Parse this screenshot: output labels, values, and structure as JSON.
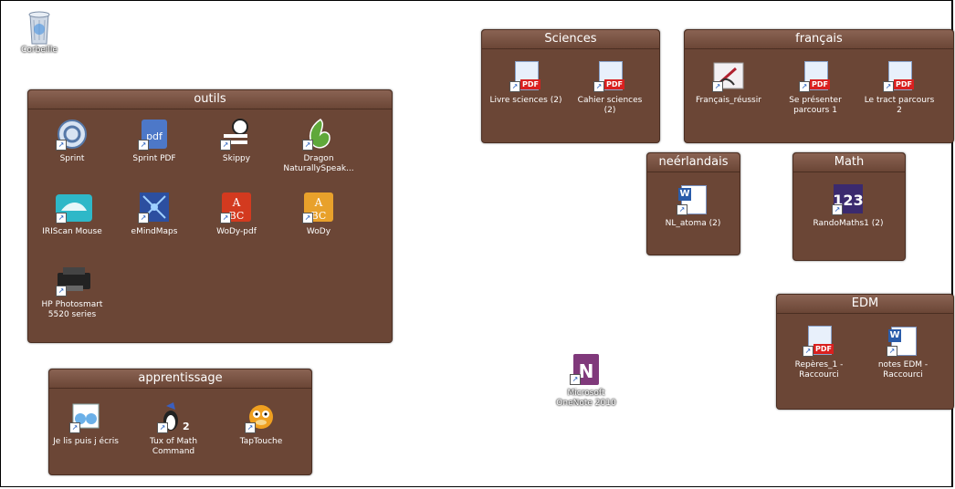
{
  "desktop": {
    "recycle_bin": "Corbeille",
    "onenote": "Microsoft OneNote 2010"
  },
  "fences": {
    "outils": {
      "title": "outils",
      "items": [
        "Sprint",
        "Sprint PDF",
        "Skippy",
        "Dragon NaturallySpeak...",
        "IRIScan Mouse",
        "eMindMaps",
        "WoDy-pdf",
        "WoDy",
        "HP Photosmart 5520 series"
      ]
    },
    "apprentissage": {
      "title": "apprentissage",
      "items": [
        "Je lis puis j écris",
        "Tux of Math Command",
        "TapTouche"
      ]
    },
    "sciences": {
      "title": "Sciences",
      "items": [
        "Livre sciences (2)",
        "Cahier sciences (2)"
      ]
    },
    "francais": {
      "title": "français",
      "items": [
        "Français_réussir",
        "Se présenter parcours 1",
        "Le tract parcours 2"
      ]
    },
    "neerlandais": {
      "title": "neérlandais",
      "items": [
        "NL_atoma (2)"
      ]
    },
    "math": {
      "title": "Math",
      "items": [
        "RandoMaths1 (2)"
      ]
    },
    "edm": {
      "title": "EDM",
      "items": [
        "Repères_1 - Raccourci",
        "notes EDM - Raccourci"
      ]
    }
  },
  "colors": {
    "fence_bg": "#6b4636",
    "fence_border": "#4a2e22",
    "pdf_red": "#d9201f",
    "word_blue": "#2a5caa",
    "onenote_purple": "#80397b"
  }
}
